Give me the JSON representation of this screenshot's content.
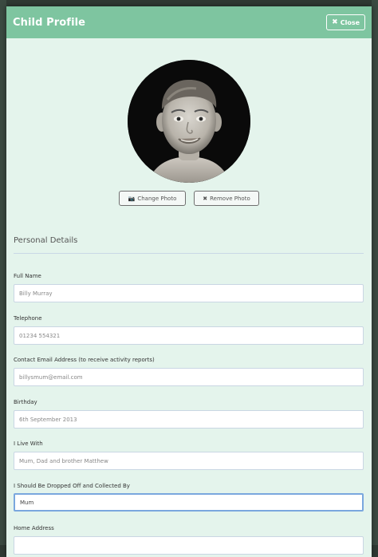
{
  "modal": {
    "title": "Child Profile",
    "close_label": "Close"
  },
  "photo": {
    "change_label": "Change Photo",
    "remove_label": "Remove Photo"
  },
  "section": {
    "title": "Personal Details"
  },
  "fields": [
    {
      "label": "Full Name",
      "value": "Billy Murray"
    },
    {
      "label": "Telephone",
      "value": "01234 554321"
    },
    {
      "label": "Contact Email Address (to receive activity reports)",
      "value": "billysmum@email.com"
    },
    {
      "label": "Birthday",
      "value": "6th September 2013"
    },
    {
      "label": "I Live With",
      "value": "Mum, Dad and brother Matthew"
    },
    {
      "label": "I Should Be Dropped Off and Collected By",
      "value": "Mum"
    },
    {
      "label": "Home Address",
      "value": ""
    }
  ],
  "icons": {
    "close": "close-icon",
    "camera": "camera-icon",
    "remove": "close-icon"
  },
  "colors": {
    "header": "#7ec5a0",
    "modal_bg": "#e4f4ec",
    "focus_border": "#7aa7de"
  }
}
